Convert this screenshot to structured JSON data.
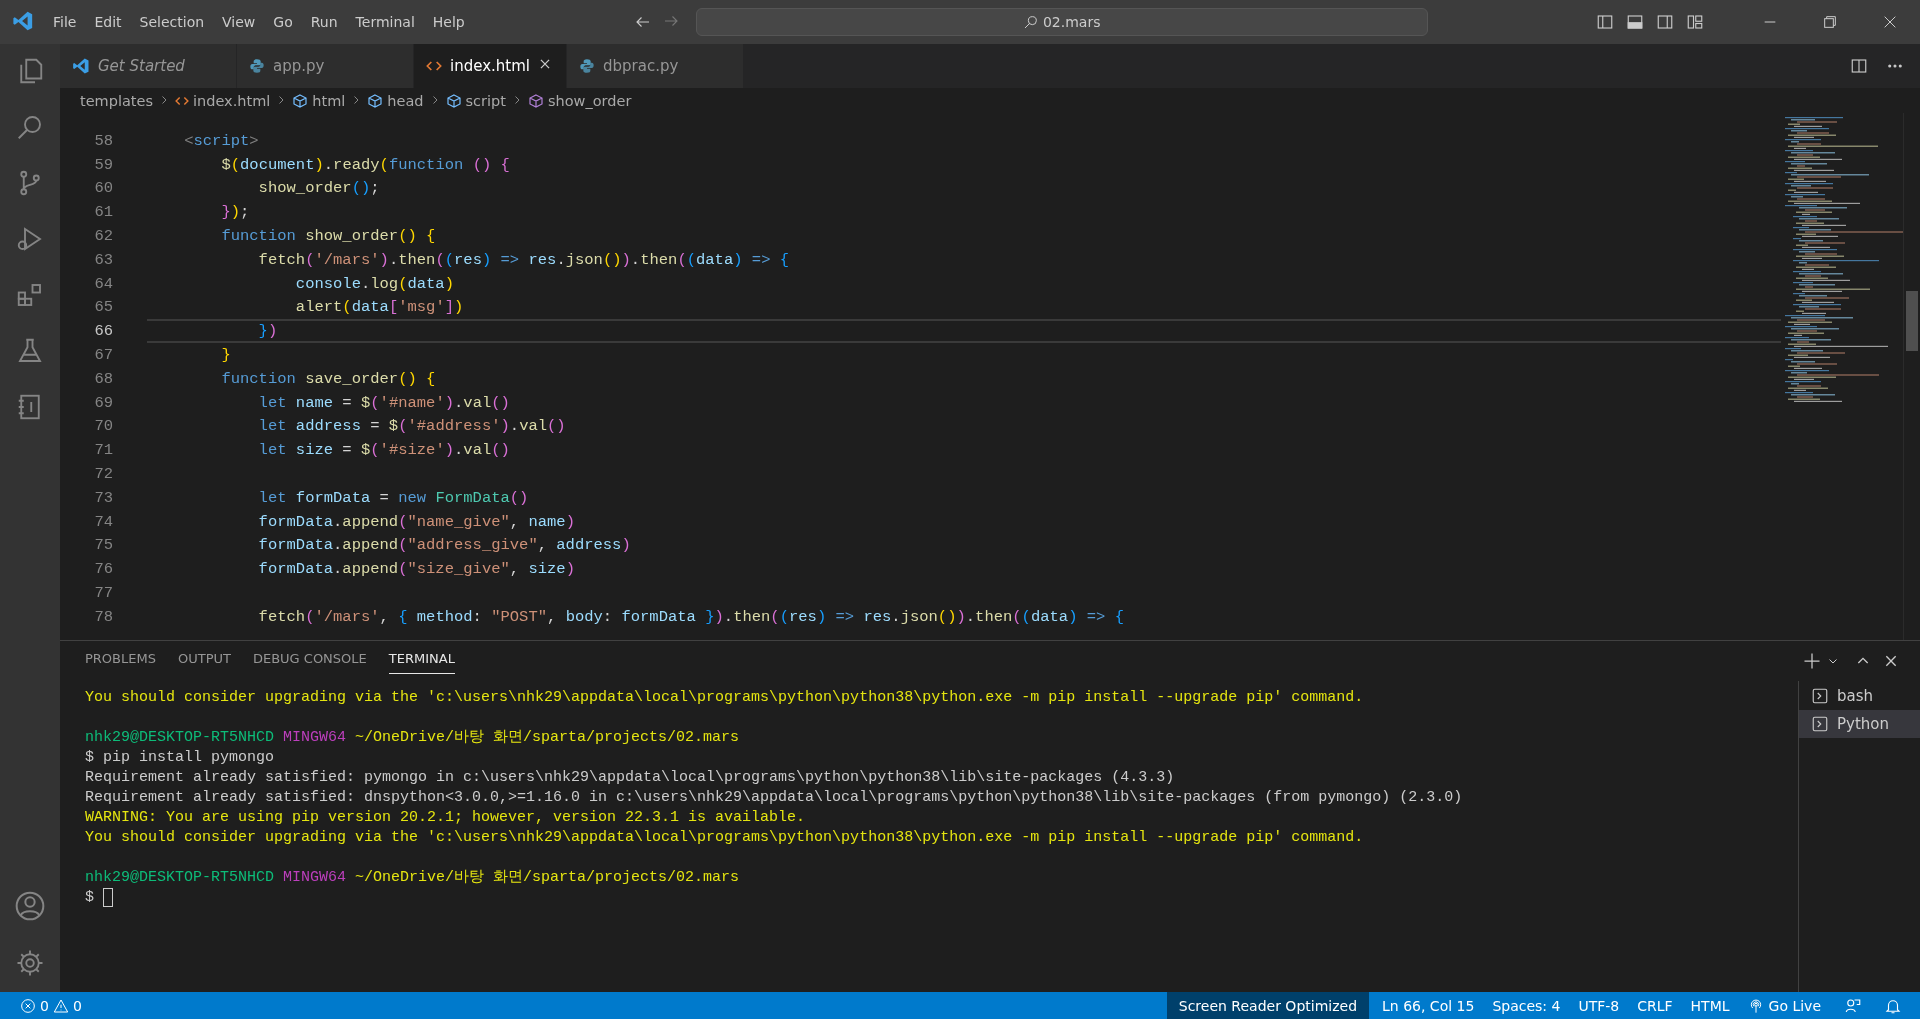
{
  "title_bar": {
    "menu": [
      "File",
      "Edit",
      "Selection",
      "View",
      "Go",
      "Run",
      "Terminal",
      "Help"
    ],
    "search": {
      "value": "02.mars"
    }
  },
  "tabs": [
    {
      "label": "Get Started",
      "kind": "welcome",
      "selected": false
    },
    {
      "label": "app.py",
      "kind": "python",
      "selected": false
    },
    {
      "label": "index.html",
      "kind": "html",
      "selected": true
    },
    {
      "label": "dbprac.py",
      "kind": "python",
      "selected": false
    }
  ],
  "breadcrumb": [
    {
      "label": "templates",
      "kind": "folder"
    },
    {
      "label": "index.html",
      "kind": "html"
    },
    {
      "label": "html",
      "kind": "element"
    },
    {
      "label": "head",
      "kind": "element"
    },
    {
      "label": "script",
      "kind": "element"
    },
    {
      "label": "show_order",
      "kind": "method"
    }
  ],
  "editor": {
    "lines": [
      {
        "num": "58",
        "current": false,
        "tokens": [
          {
            "text": "    <",
            "kind": "tag"
          },
          {
            "text": "script",
            "kind": "tname"
          },
          {
            "text": ">",
            "kind": "tag"
          }
        ]
      },
      {
        "num": "59",
        "current": false,
        "tokens": [
          {
            "text": "        $",
            "kind": "fn"
          },
          {
            "text": "(",
            "kind": "b1"
          },
          {
            "text": "document",
            "kind": "var"
          },
          {
            "text": ")",
            "kind": "b1"
          },
          {
            "text": ".",
            "kind": "p"
          },
          {
            "text": "ready",
            "kind": "fn"
          },
          {
            "text": "(",
            "kind": "b1"
          },
          {
            "text": "function ",
            "kind": "kw"
          },
          {
            "text": "() {",
            "kind": "b2"
          }
        ]
      },
      {
        "num": "60",
        "current": false,
        "tokens": [
          {
            "text": "            show_order",
            "kind": "fn"
          },
          {
            "text": "()",
            "kind": "b3"
          },
          {
            "text": ";",
            "kind": "p"
          }
        ]
      },
      {
        "num": "61",
        "current": false,
        "tokens": [
          {
            "text": "        }",
            "kind": "b2"
          },
          {
            "text": ")",
            "kind": "b1"
          },
          {
            "text": ";",
            "kind": "p"
          }
        ]
      },
      {
        "num": "62",
        "current": false,
        "tokens": [
          {
            "text": "        function ",
            "kind": "kw"
          },
          {
            "text": "show_order",
            "kind": "fn"
          },
          {
            "text": "() {",
            "kind": "b1"
          }
        ]
      },
      {
        "num": "63",
        "current": false,
        "tokens": [
          {
            "text": "            fetch",
            "kind": "fn"
          },
          {
            "text": "(",
            "kind": "b2"
          },
          {
            "text": "'/mars'",
            "kind": "str"
          },
          {
            "text": ")",
            "kind": "b2"
          },
          {
            "text": ".",
            "kind": "p"
          },
          {
            "text": "then",
            "kind": "fn"
          },
          {
            "text": "(",
            "kind": "b2"
          },
          {
            "text": "(",
            "kind": "b3"
          },
          {
            "text": "res",
            "kind": "var"
          },
          {
            "text": ")",
            "kind": "b3"
          },
          {
            "text": " => ",
            "kind": "kw"
          },
          {
            "text": "res",
            "kind": "var"
          },
          {
            "text": ".",
            "kind": "p"
          },
          {
            "text": "json",
            "kind": "fn"
          },
          {
            "text": "()",
            "kind": "b1"
          },
          {
            "text": ")",
            "kind": "b2"
          },
          {
            "text": ".",
            "kind": "p"
          },
          {
            "text": "then",
            "kind": "fn"
          },
          {
            "text": "(",
            "kind": "b2"
          },
          {
            "text": "(",
            "kind": "b3"
          },
          {
            "text": "data",
            "kind": "var"
          },
          {
            "text": ")",
            "kind": "b3"
          },
          {
            "text": " => ",
            "kind": "kw"
          },
          {
            "text": "{",
            "kind": "b3"
          }
        ]
      },
      {
        "num": "64",
        "current": false,
        "tokens": [
          {
            "text": "                console",
            "kind": "var"
          },
          {
            "text": ".",
            "kind": "p"
          },
          {
            "text": "log",
            "kind": "fn"
          },
          {
            "text": "(",
            "kind": "b1"
          },
          {
            "text": "data",
            "kind": "var"
          },
          {
            "text": ")",
            "kind": "b1"
          }
        ]
      },
      {
        "num": "65",
        "current": false,
        "tokens": [
          {
            "text": "                alert",
            "kind": "fn"
          },
          {
            "text": "(",
            "kind": "b1"
          },
          {
            "text": "data",
            "kind": "var"
          },
          {
            "text": "[",
            "kind": "b2"
          },
          {
            "text": "'msg'",
            "kind": "str"
          },
          {
            "text": "]",
            "kind": "b2"
          },
          {
            "text": ")",
            "kind": "b1"
          }
        ]
      },
      {
        "num": "66",
        "current": true,
        "tokens": [
          {
            "text": "            }",
            "kind": "b3"
          },
          {
            "text": ")",
            "kind": "b2"
          }
        ]
      },
      {
        "num": "67",
        "current": false,
        "tokens": [
          {
            "text": "        }",
            "kind": "b1"
          }
        ]
      },
      {
        "num": "68",
        "current": false,
        "tokens": [
          {
            "text": "        function ",
            "kind": "kw"
          },
          {
            "text": "save_order",
            "kind": "fn"
          },
          {
            "text": "() {",
            "kind": "b1"
          }
        ]
      },
      {
        "num": "69",
        "current": false,
        "tokens": [
          {
            "text": "            let ",
            "kind": "kw"
          },
          {
            "text": "name",
            "kind": "var"
          },
          {
            "text": " = ",
            "kind": "p"
          },
          {
            "text": "$",
            "kind": "fn"
          },
          {
            "text": "(",
            "kind": "b2"
          },
          {
            "text": "'#name'",
            "kind": "str"
          },
          {
            "text": ")",
            "kind": "b2"
          },
          {
            "text": ".",
            "kind": "p"
          },
          {
            "text": "val",
            "kind": "fn"
          },
          {
            "text": "()",
            "kind": "b2"
          }
        ]
      },
      {
        "num": "70",
        "current": false,
        "tokens": [
          {
            "text": "            let ",
            "kind": "kw"
          },
          {
            "text": "address",
            "kind": "var"
          },
          {
            "text": " = ",
            "kind": "p"
          },
          {
            "text": "$",
            "kind": "fn"
          },
          {
            "text": "(",
            "kind": "b2"
          },
          {
            "text": "'#address'",
            "kind": "str"
          },
          {
            "text": ")",
            "kind": "b2"
          },
          {
            "text": ".",
            "kind": "p"
          },
          {
            "text": "val",
            "kind": "fn"
          },
          {
            "text": "()",
            "kind": "b2"
          }
        ]
      },
      {
        "num": "71",
        "current": false,
        "tokens": [
          {
            "text": "            let ",
            "kind": "kw"
          },
          {
            "text": "size",
            "kind": "var"
          },
          {
            "text": " = ",
            "kind": "p"
          },
          {
            "text": "$",
            "kind": "fn"
          },
          {
            "text": "(",
            "kind": "b2"
          },
          {
            "text": "'#size'",
            "kind": "str"
          },
          {
            "text": ")",
            "kind": "b2"
          },
          {
            "text": ".",
            "kind": "p"
          },
          {
            "text": "val",
            "kind": "fn"
          },
          {
            "text": "()",
            "kind": "b2"
          }
        ]
      },
      {
        "num": "72",
        "current": false
      },
      {
        "num": "73",
        "current": false,
        "tokens": [
          {
            "text": "            let ",
            "kind": "kw"
          },
          {
            "text": "formData",
            "kind": "var"
          },
          {
            "text": " = ",
            "kind": "p"
          },
          {
            "text": "new ",
            "kind": "kw"
          },
          {
            "text": "FormData",
            "kind": "cls"
          },
          {
            "text": "()",
            "kind": "b2"
          }
        ]
      },
      {
        "num": "74",
        "current": false,
        "tokens": [
          {
            "text": "            formData",
            "kind": "var"
          },
          {
            "text": ".",
            "kind": "p"
          },
          {
            "text": "append",
            "kind": "fn"
          },
          {
            "text": "(",
            "kind": "b2"
          },
          {
            "text": "\"name_give\"",
            "kind": "str"
          },
          {
            "text": ", ",
            "kind": "p"
          },
          {
            "text": "name",
            "kind": "var"
          },
          {
            "text": ")",
            "kind": "b2"
          }
        ]
      },
      {
        "num": "75",
        "current": false,
        "tokens": [
          {
            "text": "            formData",
            "kind": "var"
          },
          {
            "text": ".",
            "kind": "p"
          },
          {
            "text": "append",
            "kind": "fn"
          },
          {
            "text": "(",
            "kind": "b2"
          },
          {
            "text": "\"address_give\"",
            "kind": "str"
          },
          {
            "text": ", ",
            "kind": "p"
          },
          {
            "text": "address",
            "kind": "var"
          },
          {
            "text": ")",
            "kind": "b2"
          }
        ]
      },
      {
        "num": "76",
        "current": false,
        "tokens": [
          {
            "text": "            formData",
            "kind": "var"
          },
          {
            "text": ".",
            "kind": "p"
          },
          {
            "text": "append",
            "kind": "fn"
          },
          {
            "text": "(",
            "kind": "b2"
          },
          {
            "text": "\"size_give\"",
            "kind": "str"
          },
          {
            "text": ", ",
            "kind": "p"
          },
          {
            "text": "size",
            "kind": "var"
          },
          {
            "text": ")",
            "kind": "b2"
          }
        ]
      },
      {
        "num": "77",
        "current": false
      },
      {
        "num": "78",
        "current": false,
        "tokens": [
          {
            "text": "            fetch",
            "kind": "fn"
          },
          {
            "text": "(",
            "kind": "b2"
          },
          {
            "text": "'/mars'",
            "kind": "str"
          },
          {
            "text": ", ",
            "kind": "p"
          },
          {
            "text": "{ ",
            "kind": "b3"
          },
          {
            "text": "method",
            "kind": "var"
          },
          {
            "text": ": ",
            "kind": "p"
          },
          {
            "text": "\"POST\"",
            "kind": "str"
          },
          {
            "text": ", ",
            "kind": "p"
          },
          {
            "text": "body",
            "kind": "var"
          },
          {
            "text": ": ",
            "kind": "p"
          },
          {
            "text": "formData ",
            "kind": "var"
          },
          {
            "text": "}",
            "kind": "b3"
          },
          {
            "text": ")",
            "kind": "b2"
          },
          {
            "text": ".",
            "kind": "p"
          },
          {
            "text": "then",
            "kind": "fn"
          },
          {
            "text": "(",
            "kind": "b2"
          },
          {
            "text": "(",
            "kind": "b3"
          },
          {
            "text": "res",
            "kind": "var"
          },
          {
            "text": ")",
            "kind": "b3"
          },
          {
            "text": " => ",
            "kind": "kw"
          },
          {
            "text": "res",
            "kind": "var"
          },
          {
            "text": ".",
            "kind": "p"
          },
          {
            "text": "json",
            "kind": "fn"
          },
          {
            "text": "()",
            "kind": "b1"
          },
          {
            "text": ")",
            "kind": "b2"
          },
          {
            "text": ".",
            "kind": "p"
          },
          {
            "text": "then",
            "kind": "fn"
          },
          {
            "text": "(",
            "kind": "b2"
          },
          {
            "text": "(",
            "kind": "b3"
          },
          {
            "text": "data",
            "kind": "var"
          },
          {
            "text": ")",
            "kind": "b3"
          },
          {
            "text": " => ",
            "kind": "kw"
          },
          {
            "text": "{",
            "kind": "b3"
          }
        ]
      }
    ]
  },
  "panel": {
    "tabs": [
      {
        "label": "PROBLEMS",
        "selected": false
      },
      {
        "label": "OUTPUT",
        "selected": false
      },
      {
        "label": "DEBUG CONSOLE",
        "selected": false
      },
      {
        "label": "TERMINAL",
        "selected": true
      }
    ],
    "terminal_lines": [
      {
        "kind": "text",
        "tokens": [
          {
            "text": "You should consider upgrading via the 'c:\\users\\nhk29\\appdata\\local\\programs\\python\\python38\\python.exe -m pip install --upgrade pip' command.",
            "kind": "warn"
          }
        ]
      },
      {
        "kind": "blank"
      },
      {
        "kind": "text",
        "tokens": [
          {
            "text": "nhk29@DESKTOP-RT5NHCD ",
            "kind": "user"
          },
          {
            "text": "MINGW64 ",
            "kind": "host"
          },
          {
            "text": "~/OneDrive/바탕 화면/sparta/projects/02.mars",
            "kind": "warn"
          }
        ]
      },
      {
        "kind": "text",
        "tokens": [
          {
            "text": "$ pip install pymongo",
            "kind": "plain"
          }
        ]
      },
      {
        "kind": "text",
        "tokens": [
          {
            "text": "Requirement already satisfied: pymongo in c:\\users\\nhk29\\appdata\\local\\programs\\python\\python38\\lib\\site-packages (4.3.3)",
            "kind": "plain"
          }
        ]
      },
      {
        "kind": "text",
        "tokens": [
          {
            "text": "Requirement already satisfied: dnspython<3.0.0,>=1.16.0 in c:\\users\\nhk29\\appdata\\local\\programs\\python\\python38\\lib\\site-packages (from pymongo) (2.3.0)",
            "kind": "plain"
          }
        ]
      },
      {
        "kind": "text",
        "tokens": [
          {
            "text": "WARNING: You are using pip version 20.2.1; however, version 22.3.1 is available.",
            "kind": "warn"
          }
        ]
      },
      {
        "kind": "text",
        "tokens": [
          {
            "text": "You should consider upgrading via the 'c:\\users\\nhk29\\appdata\\local\\programs\\python\\python38\\python.exe -m pip install --upgrade pip' command.",
            "kind": "warn"
          }
        ]
      },
      {
        "kind": "blank"
      },
      {
        "kind": "text",
        "tokens": [
          {
            "text": "nhk29@DESKTOP-RT5NHCD ",
            "kind": "user"
          },
          {
            "text": "MINGW64 ",
            "kind": "host"
          },
          {
            "text": "~/OneDrive/바탕 화면/sparta/projects/02.mars",
            "kind": "warn"
          }
        ]
      },
      {
        "kind": "input",
        "tokens": [
          {
            "text": "$",
            "kind": "plain"
          }
        ]
      }
    ],
    "terminals": [
      {
        "label": "bash",
        "selected": false
      },
      {
        "label": "Python",
        "selected": true
      }
    ]
  },
  "status_bar": {
    "errors": "0",
    "warnings": "0",
    "items": [
      {
        "label": "Screen Reader Optimized",
        "kind": "highlight"
      },
      {
        "label": "Ln 66, Col 15",
        "kind": "plain"
      },
      {
        "label": "Spaces: 4",
        "kind": "plain"
      },
      {
        "label": "UTF-8",
        "kind": "plain"
      },
      {
        "label": "CRLF",
        "kind": "plain"
      },
      {
        "label": "HTML",
        "kind": "plain"
      },
      {
        "label": "Go Live",
        "kind": "golive"
      }
    ]
  }
}
